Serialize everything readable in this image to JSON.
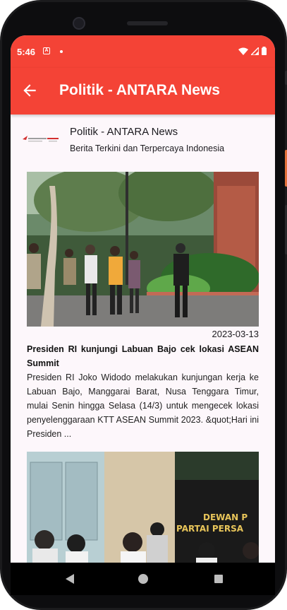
{
  "status_bar": {
    "time": "5:46",
    "notif_icon": "A"
  },
  "app_bar": {
    "title": "Politik - ANTARA News",
    "back_icon": "arrow-left-icon"
  },
  "feed": {
    "title": "Politik - ANTARA News",
    "subtitle": "Berita Terkini dan Terpercaya Indonesia",
    "logo_icon": "antara-logo-icon"
  },
  "articles": [
    {
      "date": "2023-03-13",
      "title": "Presiden RI kunjungi Labuan Bajo cek lokasi ASEAN Summit",
      "description": "Presiden RI Joko Widodo melakukan kunjungan kerja ke Labuan Bajo, Manggarai Barat, Nusa Tenggara Timur, mulai Senin hingga Selasa (14/3) untuk mengecek lokasi penyelenggaraan KTT ASEAN Summit 2023. &quot;Hari ini Presiden ..."
    },
    {
      "image_text_line1": "DEWAN P",
      "image_text_line2": "PARTAI PERSA"
    }
  ],
  "colors": {
    "accent": "#f44336",
    "background": "#fdf7fb"
  }
}
